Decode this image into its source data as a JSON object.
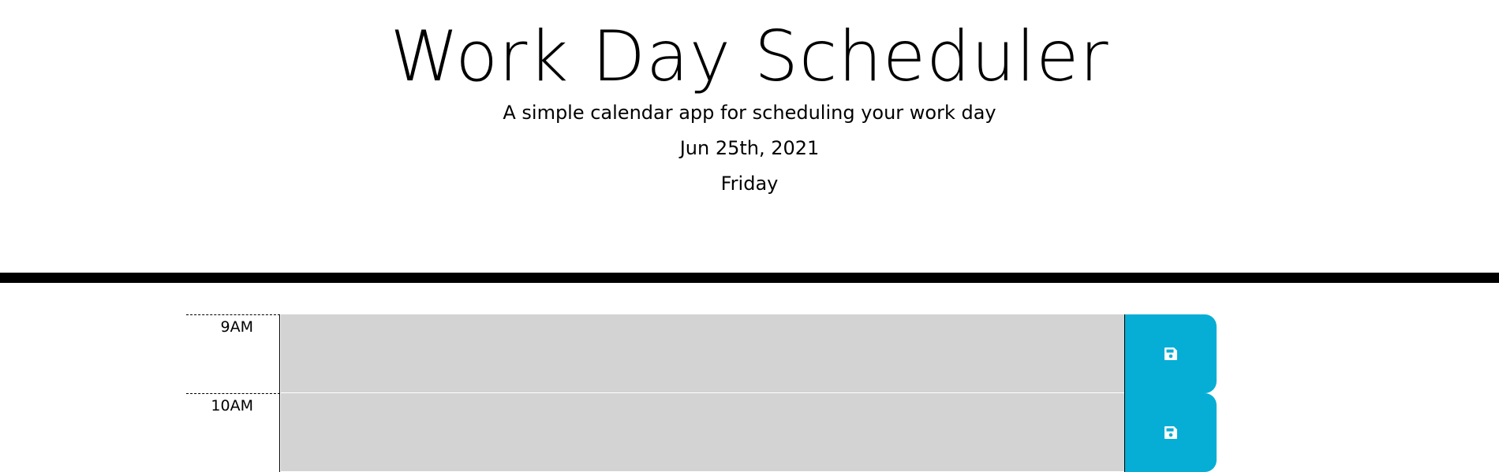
{
  "header": {
    "title": "Work Day Scheduler",
    "subtitle": "A simple calendar app for scheduling your work day",
    "date": "Jun 25th, 2021",
    "weekday": "Friday"
  },
  "colors": {
    "past": "#d3d3d3",
    "save_button": "#06aed5",
    "divider": "#000000"
  },
  "time_blocks": [
    {
      "hour": "9AM",
      "description": "",
      "save_icon": "save-icon"
    },
    {
      "hour": "10AM",
      "description": "",
      "save_icon": "save-icon"
    }
  ]
}
